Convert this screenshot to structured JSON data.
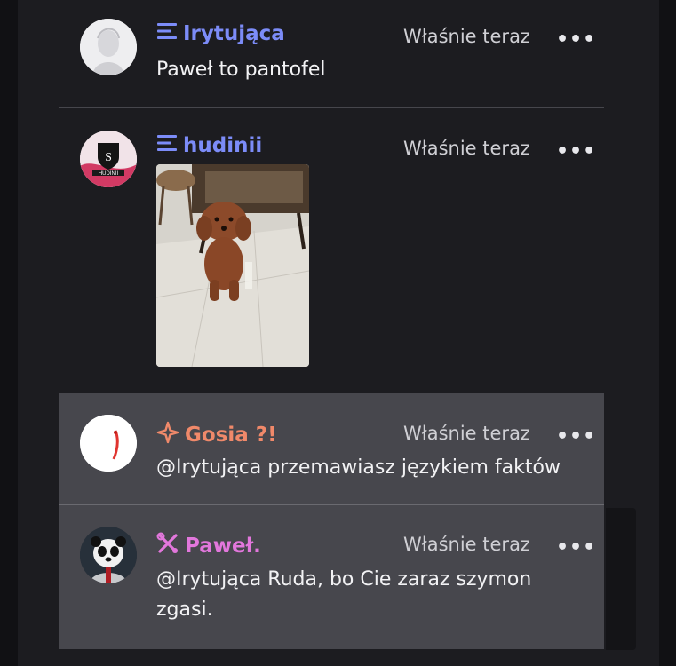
{
  "messages": [
    {
      "author": "Irytująca",
      "role_icon": "menu-lines-icon",
      "name_color": "#7c8cf8",
      "time": "Właśnie teraz",
      "more": "•••",
      "text": "Paweł to pantofel"
    },
    {
      "author": "hudinii",
      "role_icon": "menu-lines-icon",
      "name_color": "#7c8cf8",
      "time": "Właśnie teraz",
      "more": "•••",
      "avatar_text": "HUDINII",
      "image": "poodle-photo"
    },
    {
      "author": "Gosia ?!",
      "role_icon": "sparkle-icon",
      "name_color": "#f0896a",
      "time": "Właśnie teraz",
      "more": "•••",
      "text": "@Irytująca przemawiasz językiem faktów"
    },
    {
      "author": "Paweł.",
      "role_icon": "tools-icon",
      "name_color": "#e277dc",
      "time": "Właśnie teraz",
      "more": "•••",
      "text": "@Irytująca Ruda, bo Cie zaraz szymon zgasi."
    }
  ],
  "colors": {
    "background": "#1c1c20",
    "highlight": "#47474d",
    "text": "#f2f2f4"
  }
}
